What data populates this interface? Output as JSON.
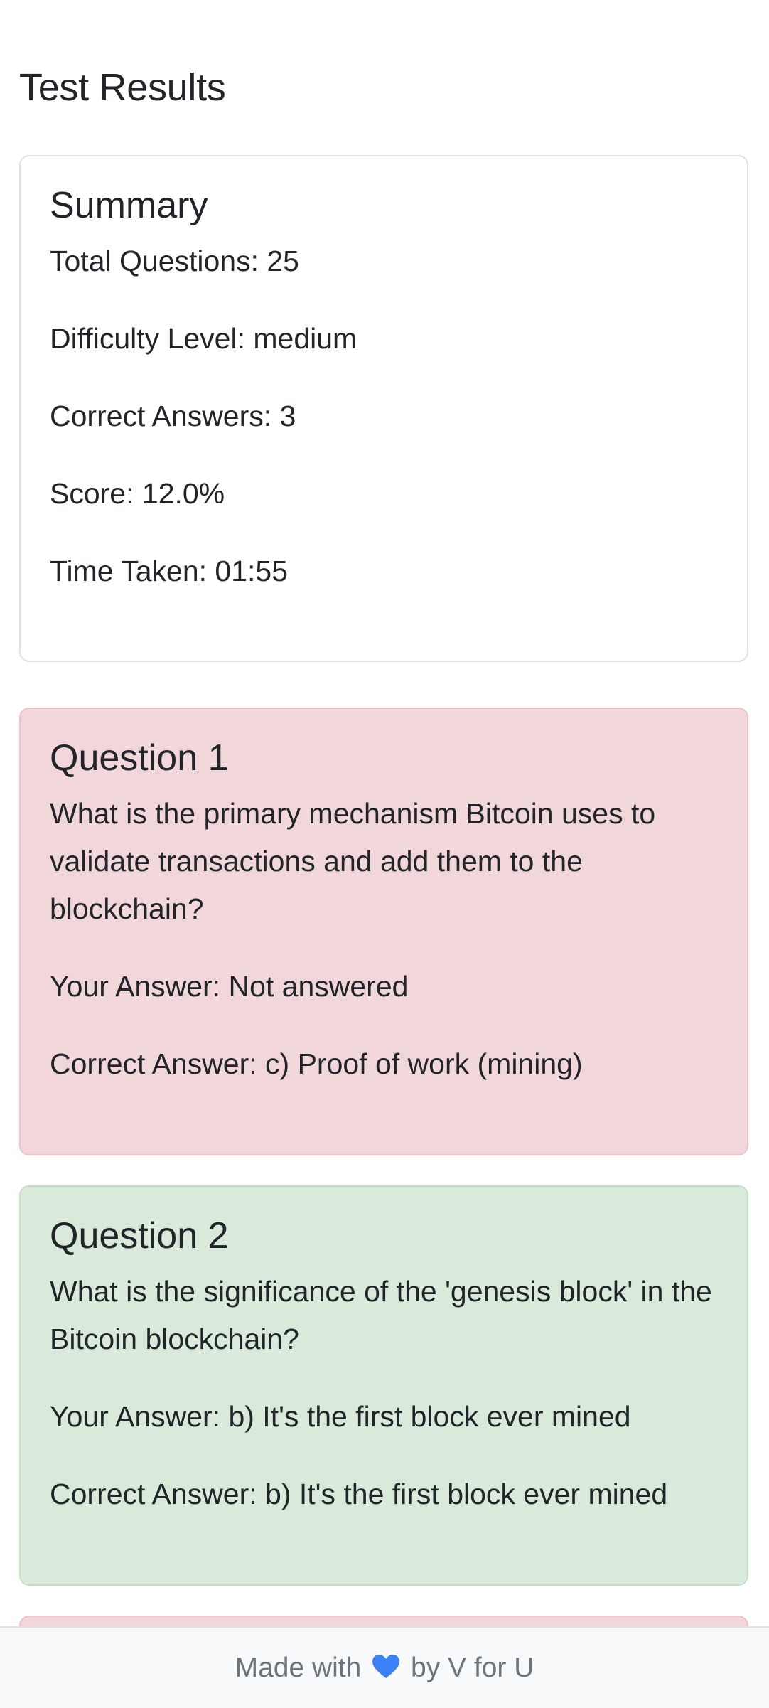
{
  "page": {
    "title": "Test Results"
  },
  "summary": {
    "title": "Summary",
    "total_questions": "Total Questions: 25",
    "difficulty": "Difficulty Level: medium",
    "correct_answers": "Correct Answers: 3",
    "score": "Score: 12.0%",
    "time_taken": "Time Taken: 01:55"
  },
  "questions": [
    {
      "title": "Question 1",
      "text": "What is the primary mechanism Bitcoin uses to validate transactions and add them to the blockchain?",
      "your_answer": "Your Answer: Not answered",
      "correct_answer": "Correct Answer: c) Proof of work (mining)",
      "status": "incorrect"
    },
    {
      "title": "Question 2",
      "text": "What is the significance of the 'genesis block' in the Bitcoin blockchain?",
      "your_answer": "Your Answer: b) It's the first block ever mined",
      "correct_answer": "Correct Answer: b) It's the first block ever mined",
      "status": "correct"
    },
    {
      "status": "incorrect"
    }
  ],
  "footer": {
    "prefix": "Made with",
    "icon": "blue-heart-icon",
    "suffix": "by V for U"
  },
  "colors": {
    "incorrect_bg": "#f2d7da",
    "correct_bg": "#d9eadb",
    "heart": "#3b82f6"
  }
}
